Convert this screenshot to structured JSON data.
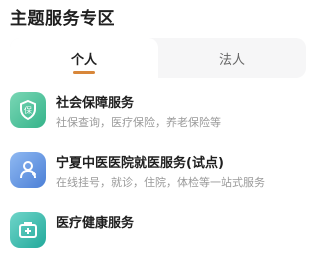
{
  "section": {
    "title": "主题服务专区"
  },
  "tabs": [
    {
      "label": "个人",
      "active": true
    },
    {
      "label": "法人",
      "active": false
    }
  ],
  "services": [
    {
      "title": "社会保障服务",
      "desc": "社保查询，医疗保险，养老保险等",
      "icon": "shield-icon",
      "color": "#34b38a"
    },
    {
      "title": "宁夏中医医院就医服务(试点)",
      "desc": "在线挂号，就诊，住院，体检等一站式服务",
      "icon": "doctor-icon",
      "color": "#4b7fd6"
    },
    {
      "title": "医疗健康服务",
      "desc": "",
      "icon": "medical-kit-icon",
      "color": "#22a99b"
    }
  ]
}
